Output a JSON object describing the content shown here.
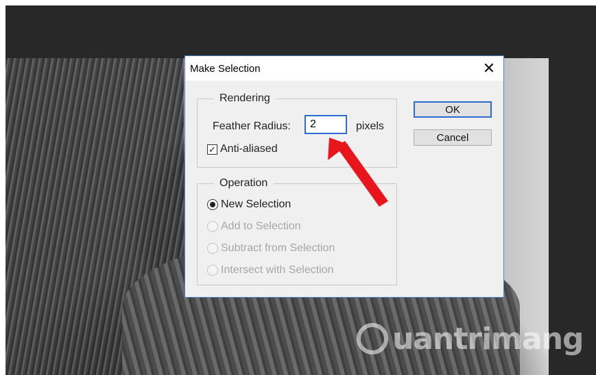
{
  "dialog": {
    "title": "Make Selection",
    "close_glyph": "✕",
    "rendering": {
      "legend": "Rendering",
      "feather_label": "Feather Radius:",
      "feather_value": "2",
      "feather_unit": "pixels",
      "anti_aliased_label": "Anti-aliased",
      "anti_aliased_checked": true
    },
    "operation": {
      "legend": "Operation",
      "options": [
        {
          "label": "New Selection",
          "selected": true,
          "enabled": true
        },
        {
          "label": "Add to Selection",
          "selected": false,
          "enabled": false
        },
        {
          "label": "Subtract from Selection",
          "selected": false,
          "enabled": false
        },
        {
          "label": "Intersect with Selection",
          "selected": false,
          "enabled": false
        }
      ]
    },
    "buttons": {
      "ok": "OK",
      "cancel": "Cancel"
    }
  },
  "watermark": {
    "text": "uantrimang",
    "logo_letter": "Q"
  },
  "colors": {
    "arrow": "#e8161c",
    "focus": "#2b6bd1",
    "workspace": "#282828"
  },
  "icons": {
    "close": "close-icon",
    "arrow": "red-arrow-annotation"
  }
}
